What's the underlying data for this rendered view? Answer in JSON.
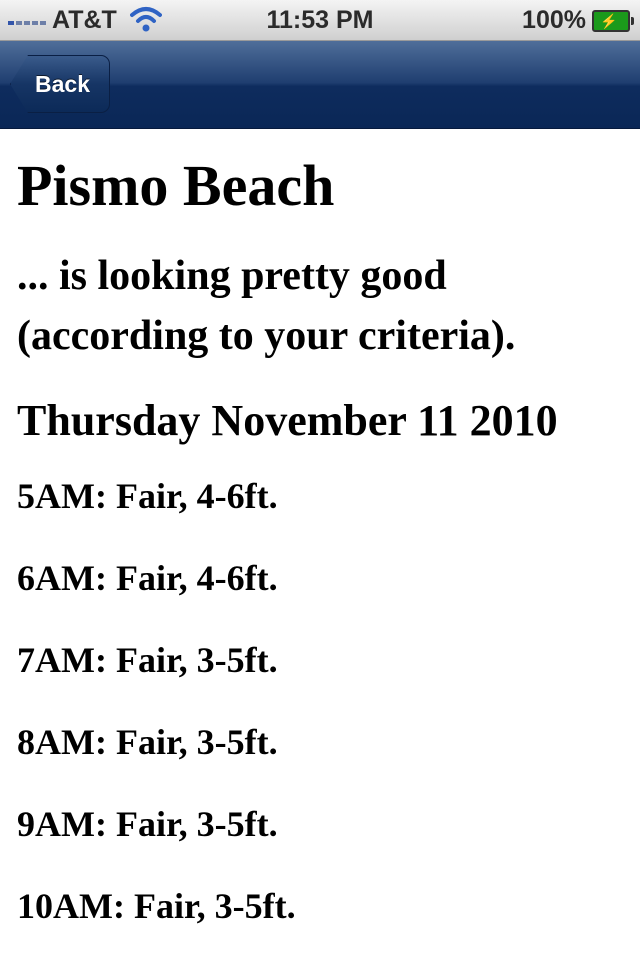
{
  "status_bar": {
    "carrier": "AT&T",
    "time": "11:53 PM",
    "battery": "100%",
    "signal_icon": "signal-bars-icon",
    "wifi_icon": "wifi-icon",
    "battery_icon": "battery-charging-icon"
  },
  "nav": {
    "back_label": "Back"
  },
  "main": {
    "beach_name": "Pismo Beach",
    "subtitle": "... is looking pretty good (according to your criteria).",
    "date": "Thursday November 11 2010",
    "forecasts": [
      "5AM: Fair, 4-6ft.",
      "6AM: Fair, 4-6ft.",
      "7AM: Fair, 3-5ft.",
      "8AM: Fair, 3-5ft.",
      "9AM: Fair, 3-5ft.",
      "10AM: Fair, 3-5ft."
    ]
  },
  "colors": {
    "nav_bar": "#0e2c5e",
    "battery_fill": "#1b9a1b"
  }
}
